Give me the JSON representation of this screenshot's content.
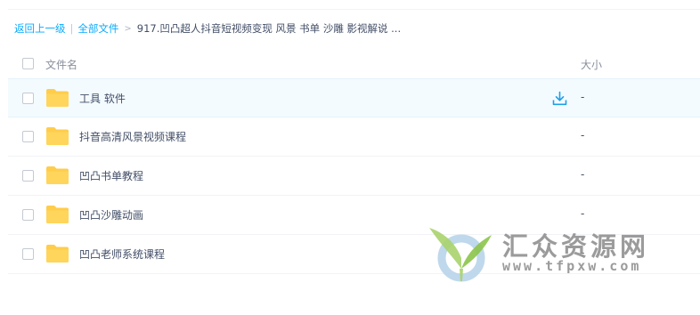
{
  "breadcrumb": {
    "back_label": "返回上一级",
    "separator": "|",
    "root_label": "全部文件",
    "arrow": ">",
    "current": "917.凹凸超人抖音短视频变现 风景 书单 沙雕 影视解说 ..."
  },
  "table": {
    "header_name": "文件名",
    "header_size": "大小",
    "rows": [
      {
        "name": "工具 软件",
        "size": "-",
        "type": "folder",
        "hovered": true
      },
      {
        "name": "抖音高清风景视频课程",
        "size": "-",
        "type": "folder"
      },
      {
        "name": "凹凸书单教程",
        "size": "-",
        "type": "folder"
      },
      {
        "name": "凹凸沙雕动画",
        "size": "-",
        "type": "folder"
      },
      {
        "name": "凹凸老师系统课程",
        "size": "-",
        "type": "folder"
      }
    ]
  },
  "icons": {
    "folder": "folder-icon",
    "download": "download-icon",
    "checkbox": "checkbox"
  },
  "watermark": {
    "title": "汇众资源网",
    "url": "www.tfpxw.com"
  },
  "colors": {
    "link": "#09aaff",
    "folder": "#ffcd4b",
    "hover_row": "#f4fbff",
    "text": "#424e67",
    "muted": "#888f9c"
  }
}
